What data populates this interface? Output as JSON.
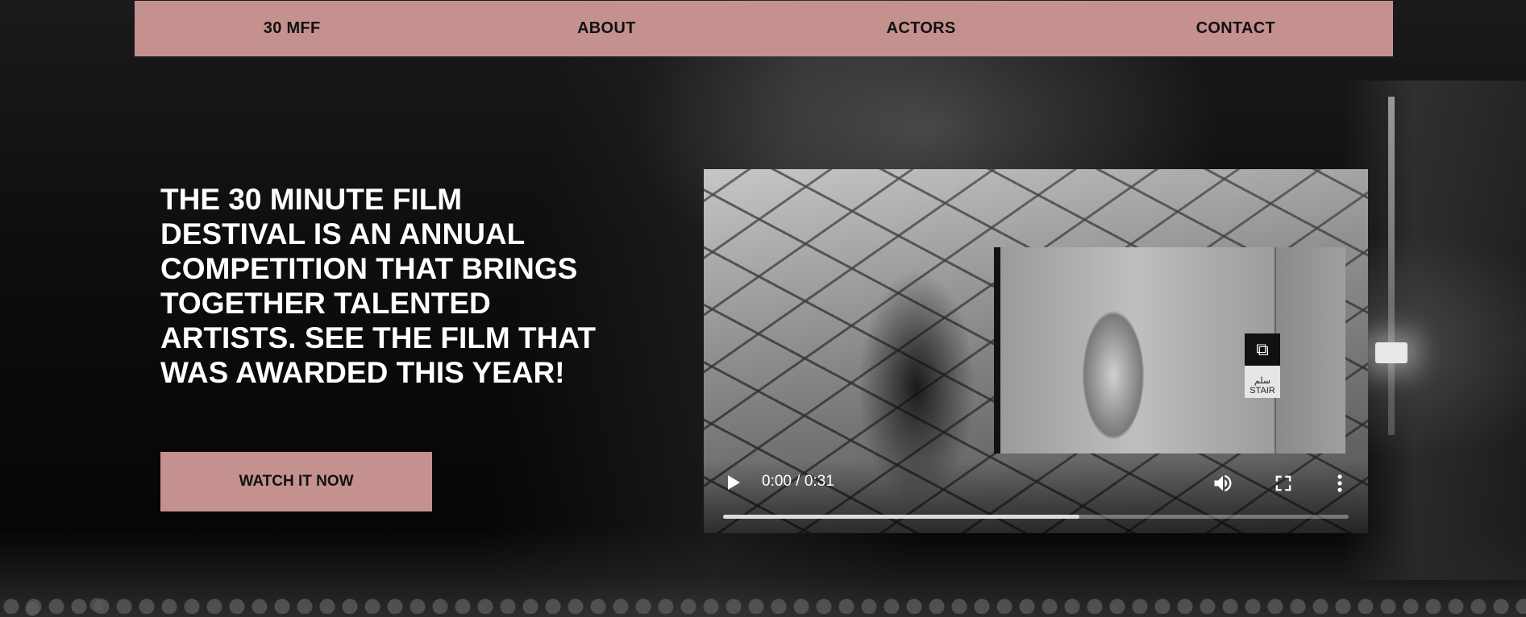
{
  "nav": {
    "items": [
      {
        "label": "30 MFF"
      },
      {
        "label": "ABOUT"
      },
      {
        "label": "ACTORS"
      },
      {
        "label": "CONTACT"
      }
    ]
  },
  "hero": {
    "text": "THE 30 MINUTE FILM DESTIVAL IS AN ANNUAL COMPETITION THAT BRINGS TOGETHER TALENTED ARTISTS. SEE THE FILM THAT WAS AWARDED THIS YEAR!",
    "cta_label": "WATCH IT NOW"
  },
  "video": {
    "time_display": "0:00 / 0:31",
    "buffered_fraction": 0.57,
    "sign_text": "STAIR",
    "sign_arabic": "سلم"
  },
  "colors": {
    "accent": "#c4918e",
    "text_dark": "#111111"
  }
}
